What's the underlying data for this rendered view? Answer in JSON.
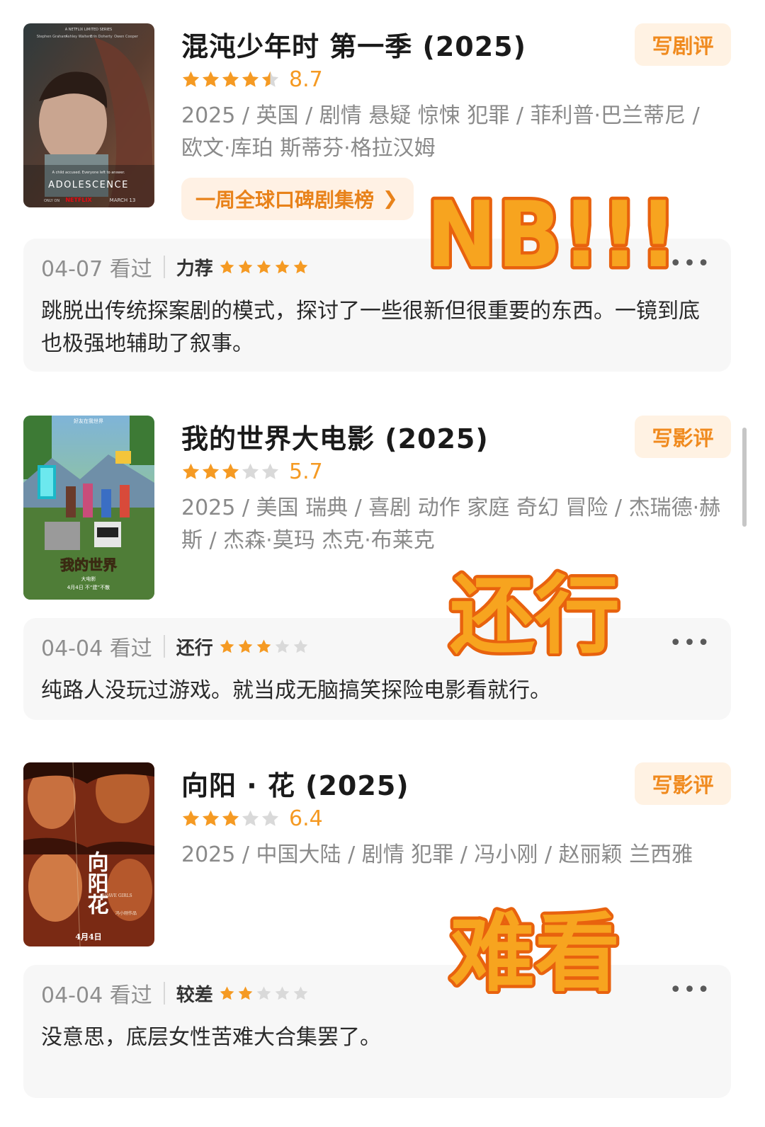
{
  "colors": {
    "accent": "#f59a23",
    "star_empty": "#d9d9d9",
    "sticker_fill": "#f7a41f",
    "sticker_outline": "#e8620e"
  },
  "entries": [
    {
      "title": "混沌少年时 第一季 (2025)",
      "rating_stars": 4.5,
      "score": "8.7",
      "meta": "2025 / 英国 / 剧情 悬疑 惊悚 犯罪 / 菲利普·巴兰蒂尼 / 欧文·库珀 斯蒂芬·格拉汉姆",
      "review_button": "写剧评",
      "rank_tag": "一周全球口碑剧集榜",
      "rank_tag_icon": "chevron-right-icon",
      "poster": {
        "top_line": "A NETFLIX LIMITED SERIES",
        "cast": [
          "Stephen Graham",
          "Ashley Walters",
          "Erin Doherty",
          "Owen Cooper"
        ],
        "tagline": "A child accused. Everyone left to answer.",
        "title": "ADOLESCENCE",
        "only_on": "ONLY ON",
        "netflix": "NETFLIX",
        "date": "MARCH 13"
      },
      "review": {
        "watched": "04-07 看过",
        "verdict": "力荐",
        "user_stars": 5,
        "text": "跳脱出传统探案剧的模式，探讨了一些很新但很重要的东西。一镜到底也极强地辅助了叙事。"
      },
      "sticker": "NB!!!"
    },
    {
      "title": "我的世界大电影 (2025)",
      "rating_stars": 3,
      "score": "5.7",
      "meta": "2025 / 美国 瑞典 / 喜剧 动作 家庭 奇幻 冒险 / 杰瑞德·赫斯 / 杰森·莫玛 杰克·布莱克",
      "review_button": "写影评",
      "poster": {
        "top_line": "好友在我世界",
        "title": "我的世界",
        "subtitle": "大电影",
        "date": "4月4日 不“建”不散"
      },
      "review": {
        "watched": "04-04 看过",
        "verdict": "还行",
        "user_stars": 3,
        "text": "纯路人没玩过游戏。就当成无脑搞笑探险电影看就行。"
      },
      "sticker": "还行"
    },
    {
      "title": "向阳 · 花 (2025)",
      "rating_stars": 3,
      "score": "6.4",
      "meta": "2025 / 中国大陆 / 剧情 犯罪 / 冯小刚 / 赵丽颖 兰西雅",
      "review_button": "写影评",
      "poster": {
        "title": "向阳花",
        "english": "BRAVE GIRLS",
        "director": "冯小刚作品",
        "date": "4月4日"
      },
      "review": {
        "watched": "04-04 看过",
        "verdict": "较差",
        "user_stars": 2,
        "text": "没意思，底层女性苦难大合集罢了。"
      },
      "sticker": "难看"
    }
  ],
  "more_icon": "more-dots-icon"
}
